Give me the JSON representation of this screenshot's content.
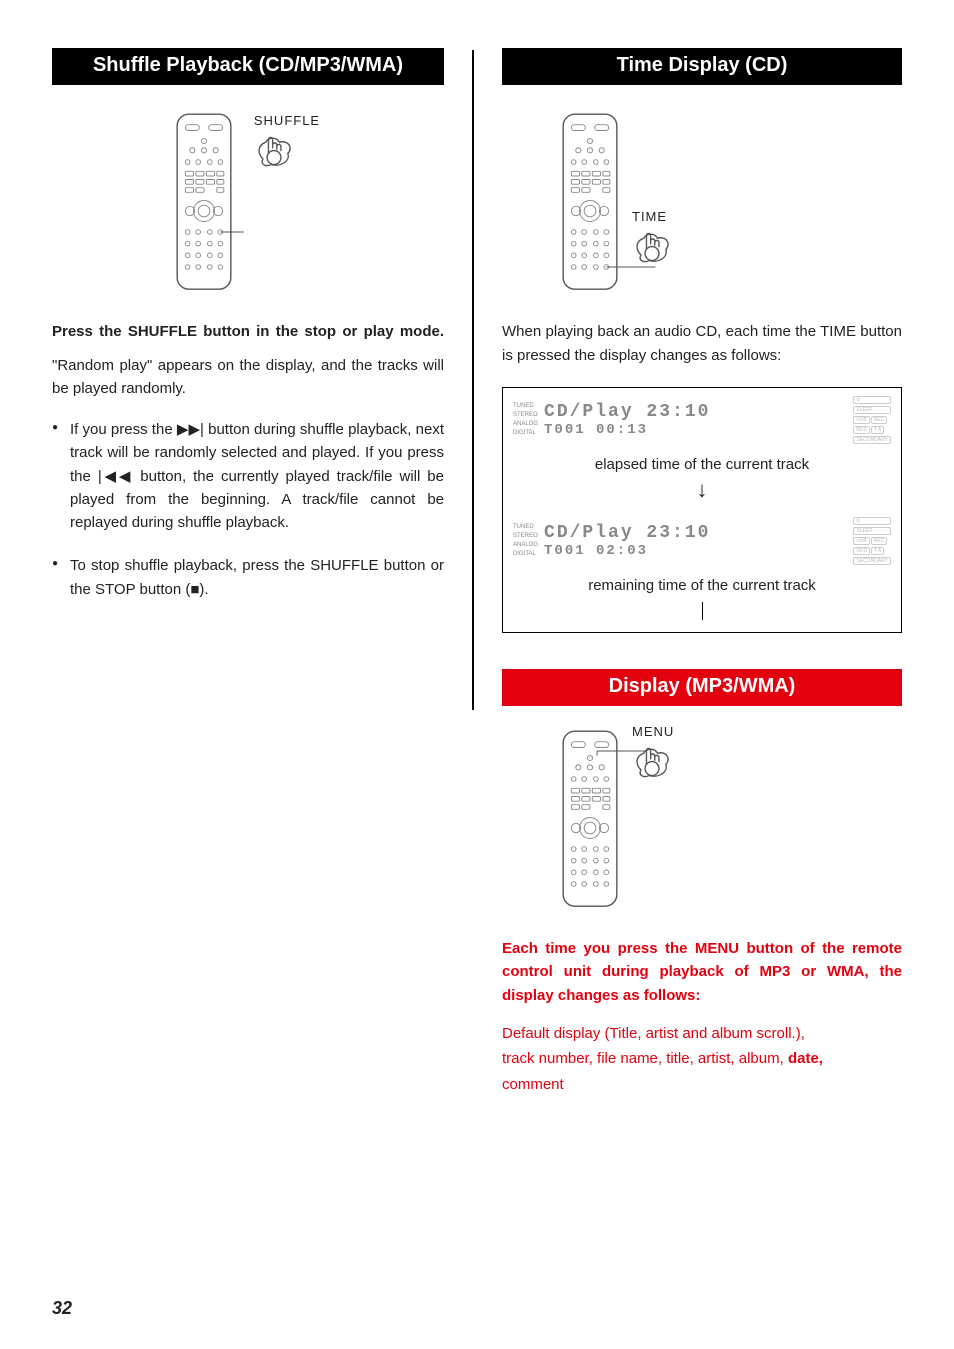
{
  "page_number": "32",
  "left": {
    "title": "Shuffle Playback (CD/MP3/WMA)",
    "button_label": "SHUFFLE",
    "press_heading": "Press the SHUFFLE button in the stop or play mode.",
    "press_body": "\"Random play\" appears on the display, and the tracks will be played randomly.",
    "bullet1_a": "If you press the ",
    "bullet1_b": " button during shuffle playback, next track will be randomly selected and played. If you press the ",
    "bullet1_c": " button, the currently played track/file will be played from the beginning. A track/file cannot be replayed during shuffle playback.",
    "next_icon": "▶▶|",
    "prev_icon": "|◀◀",
    "bullet2_a": "To stop shuffle playback, press the SHUFFLE button or the STOP button (",
    "bullet2_b": ").",
    "stop_icon": "■"
  },
  "right": {
    "title_time": "Time Display (CD)",
    "button_label_time": "TIME",
    "intro": "When playing back an audio CD, each time the TIME button is pressed the display changes as follows:",
    "panel1_lcd_top": "CD/Play     23:10",
    "panel1_lcd_bot": "T001   00:13",
    "caption1": "elapsed time of the current track",
    "panel2_lcd_top": "CD/Play     23:10",
    "panel2_lcd_bot": "T001   02:03",
    "caption2": "remaining time of the current track",
    "tags": {
      "a": "TUNED",
      "b": "STEREO",
      "c": "ANALOG",
      "d": "DIGITAL"
    },
    "side": {
      "a": "SLEEP",
      "b": "USB",
      "c": "REC",
      "d": "RDS",
      "e": "T A",
      "f": "SECONDARY"
    },
    "title_mp3": "Display (MP3/WMA)",
    "button_label_menu": "MENU",
    "mp3_heading": "Each time you press the MENU button of the remote control unit during playback of MP3 or WMA, the display changes as follows:",
    "mp3_list_a": "Default display (Title, artist and album scroll.),",
    "mp3_list_b1": "track number, file name, title, artist, album, ",
    "mp3_list_b2": "date,",
    "mp3_list_c": "comment"
  }
}
